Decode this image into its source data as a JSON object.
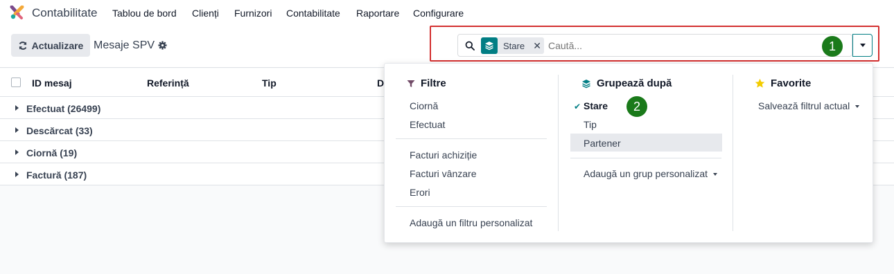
{
  "topnav": {
    "app_name": "Contabilitate",
    "items": [
      "Tablou de bord",
      "Clienți",
      "Furnizori",
      "Contabilitate",
      "Raportare",
      "Configurare"
    ]
  },
  "controlbar": {
    "refresh_label": "Actualizare",
    "page_title": "Mesaje SPV"
  },
  "search": {
    "facet_label": "Stare",
    "placeholder": "Caută..."
  },
  "annotations": [
    "1",
    "2"
  ],
  "list": {
    "headers": [
      "ID mesaj",
      "Referință",
      "Tip",
      "D"
    ],
    "groups": [
      "Efectuat (26499)",
      "Descărcat (33)",
      "Ciornă (19)",
      "Factură (187)"
    ]
  },
  "dropdown": {
    "filters": {
      "title": "Filtre",
      "group1": [
        "Ciornă",
        "Efectuat"
      ],
      "group2": [
        "Facturi achiziție",
        "Facturi vânzare",
        "Erori"
      ],
      "custom": "Adaugă un filtru personalizat"
    },
    "groupby": {
      "title": "Grupează după",
      "items": [
        "Stare",
        "Tip",
        "Partener"
      ],
      "custom": "Adaugă un grup personalizat"
    },
    "favorites": {
      "title": "Favorite",
      "save": "Salvează filtrul actual"
    }
  },
  "colors": {
    "accent": "#017e84",
    "filter_icon": "#714b67",
    "star": "#f3cc00",
    "badge": "#1a7a1a",
    "highlight_border": "#d32f2f"
  }
}
